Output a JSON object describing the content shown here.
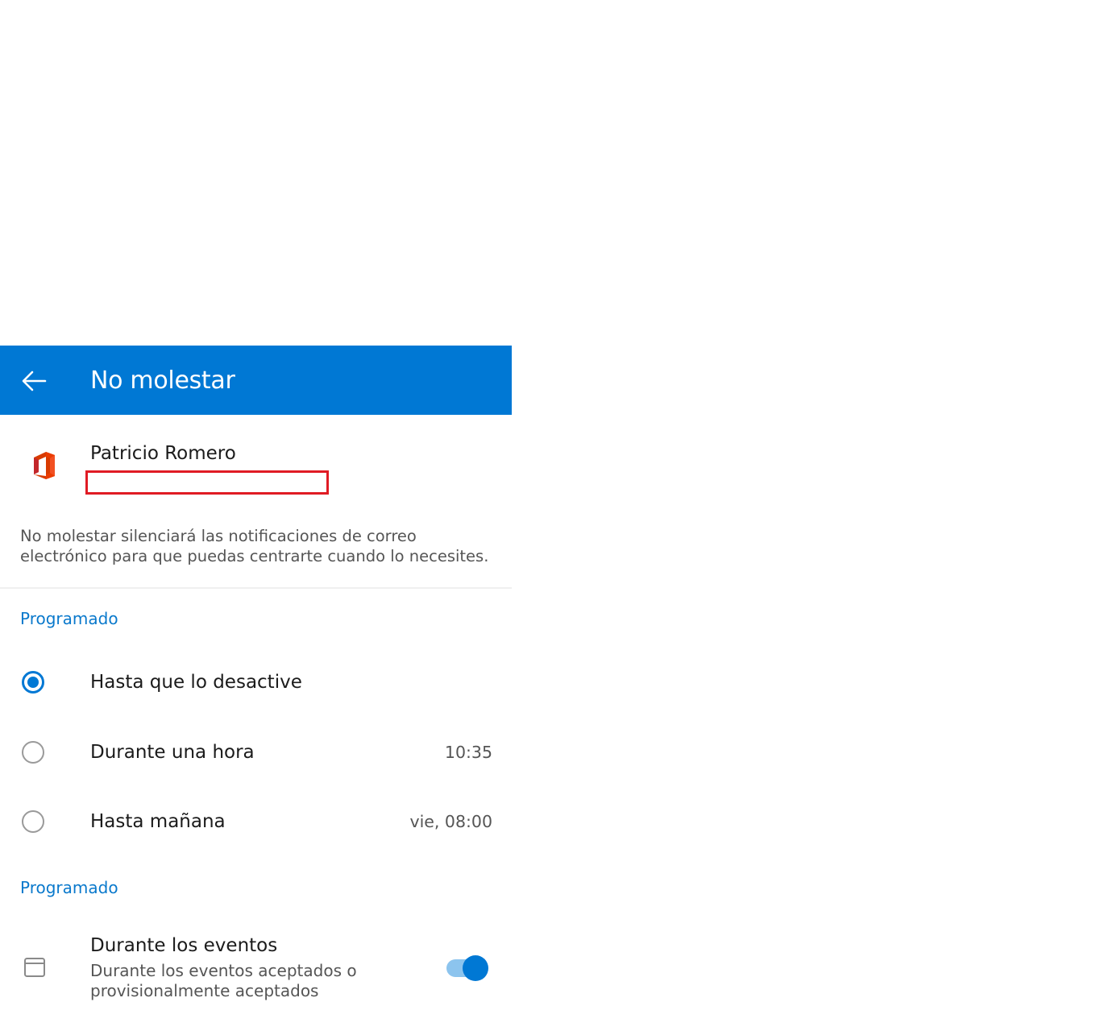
{
  "app_bar": {
    "title": "No molestar",
    "back_icon": "arrow-left-icon",
    "background": "#0078d4"
  },
  "account": {
    "name": "Patricio Romero",
    "icon": "office-logo-icon"
  },
  "description": "No molestar silenciará las notificaciones de correo electrónico para que puedas centrarte cuando lo necesites.",
  "sections": [
    {
      "header": "Programado",
      "options": [
        {
          "label": "Hasta que lo desactive",
          "time": "",
          "selected": true
        },
        {
          "label": "Durante una hora",
          "time": "10:35",
          "selected": false
        },
        {
          "label": "Hasta mañana",
          "time": "vie, 08:00",
          "selected": false
        }
      ]
    },
    {
      "header": "Programado",
      "events": {
        "title": "Durante los eventos",
        "subtitle": "Durante los eventos aceptados o provisionalmente aceptados",
        "icon": "calendar-icon",
        "enabled": true
      }
    }
  ],
  "colors": {
    "accent": "#0078d4",
    "section_header": "#0a79cc",
    "redaction_border": "#e01b24"
  }
}
